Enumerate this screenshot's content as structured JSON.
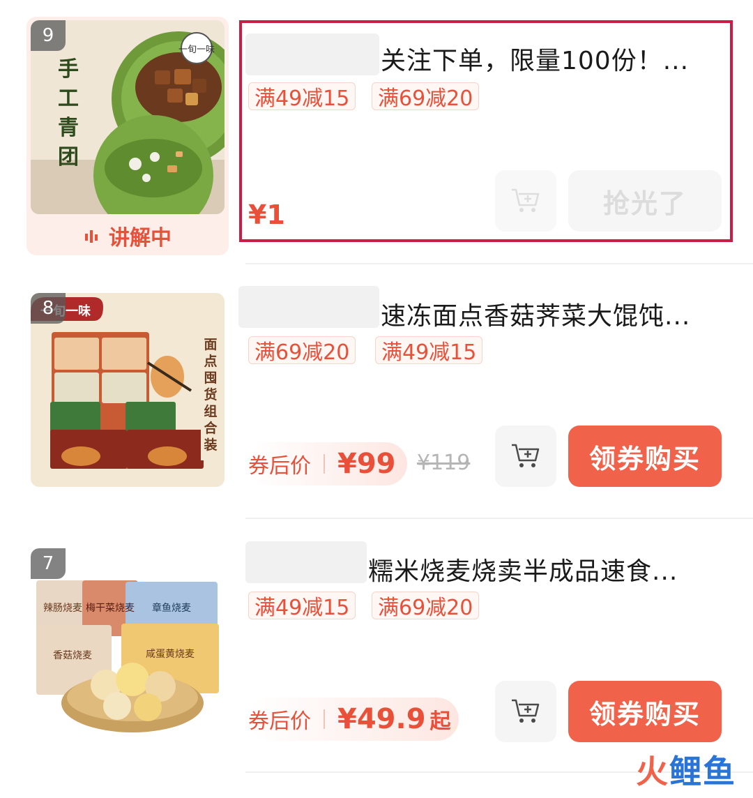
{
  "products": [
    {
      "rank": "9",
      "live_label": "讲解中",
      "title": "关注下单，限量100份！...",
      "tags": [
        "满49减15",
        "满69减20"
      ],
      "price": "¥1",
      "buy_label": "抢光了",
      "buy_state": "sold-out",
      "image": {
        "brand": "一旬一味",
        "vertical_text": [
          "手",
          "工",
          "青",
          "团"
        ]
      }
    },
    {
      "rank": "8",
      "title": "速冻面点香菇荠菜大馄饨...",
      "tags": [
        "满69减20",
        "满49减15"
      ],
      "price_label": "券后价",
      "price": "¥99",
      "original_price": "¥119",
      "buy_label": "领券购买",
      "buy_state": "active",
      "image": {
        "brand": "一旬一味",
        "vertical_text": [
          "面",
          "点",
          "囤",
          "货",
          "组",
          "合",
          "装"
        ]
      }
    },
    {
      "rank": "7",
      "title": "糯米烧麦烧卖半成品速食...",
      "tags": [
        "满49减15",
        "满69减20"
      ],
      "price_label": "券后价",
      "price": "¥49.9",
      "price_suffix": "起",
      "buy_label": "领券购买",
      "buy_state": "active",
      "image": {
        "packs": [
          "辣肠烧麦",
          "梅干菜烧麦",
          "章鱼烧麦",
          "香菇烧麦",
          "咸蛋黄烧麦"
        ]
      }
    }
  ],
  "watermark": {
    "chars": [
      "火",
      "鲤",
      "鱼"
    ]
  },
  "colors": {
    "accent": "#e8503a",
    "button": "#f0624a",
    "highlight": "#c81e46"
  },
  "icons": [
    "cart-plus-icon",
    "sound-wave-icon"
  ]
}
